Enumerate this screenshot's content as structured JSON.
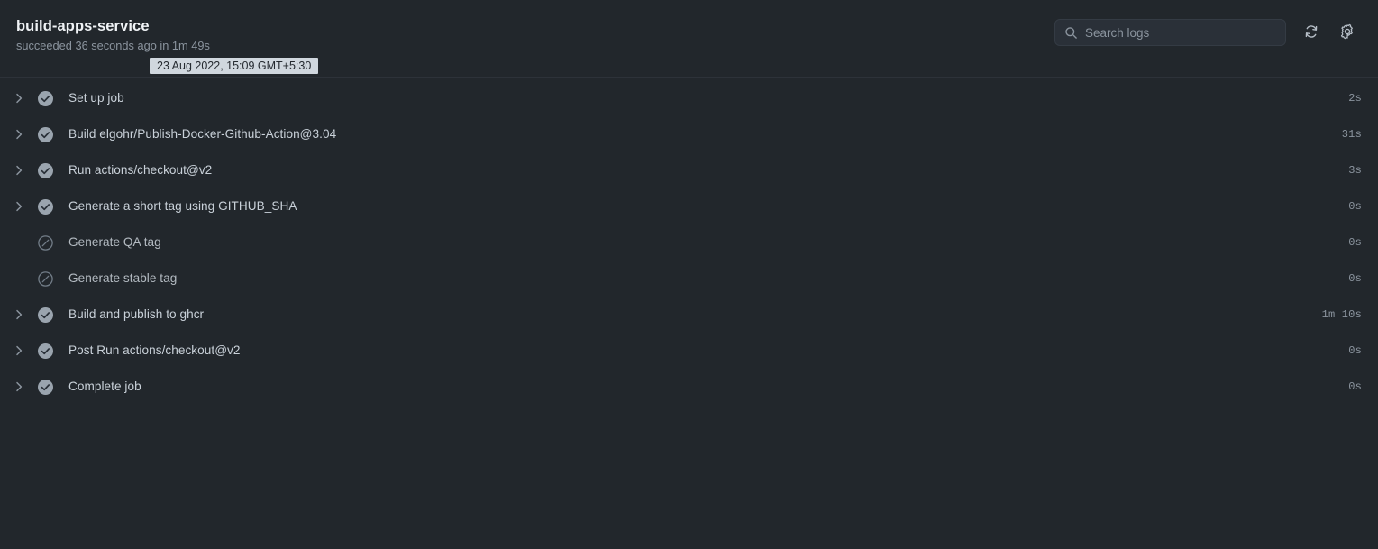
{
  "header": {
    "job_title": "build-apps-service",
    "status_line": "succeeded 36 seconds ago in 1m 49s",
    "tooltip": "23 Aug 2022, 15:09 GMT+5:30",
    "search": {
      "placeholder": "Search logs",
      "value": "",
      "icon": "search-icon"
    },
    "actions": [
      {
        "name": "refresh-button",
        "icon": "refresh-icon",
        "label": "Refresh"
      },
      {
        "name": "settings-button",
        "icon": "gear-icon",
        "label": "Settings"
      }
    ]
  },
  "steps": [
    {
      "label": "Set up job",
      "duration": "2s",
      "status": "success",
      "expandable": true
    },
    {
      "label": "Build elgohr/Publish-Docker-Github-Action@3.04",
      "duration": "31s",
      "status": "success",
      "expandable": true
    },
    {
      "label": "Run actions/checkout@v2",
      "duration": "3s",
      "status": "success",
      "expandable": true
    },
    {
      "label": "Generate a short tag using GITHUB_SHA",
      "duration": "0s",
      "status": "success",
      "expandable": true
    },
    {
      "label": "Generate QA tag",
      "duration": "0s",
      "status": "skipped",
      "expandable": false
    },
    {
      "label": "Generate stable tag",
      "duration": "0s",
      "status": "skipped",
      "expandable": false
    },
    {
      "label": "Build and publish to ghcr",
      "duration": "1m 10s",
      "status": "success",
      "expandable": true
    },
    {
      "label": "Post Run actions/checkout@v2",
      "duration": "0s",
      "status": "success",
      "expandable": true
    },
    {
      "label": "Complete job",
      "duration": "0s",
      "status": "success",
      "expandable": true
    }
  ],
  "colors": {
    "background": "#22272c",
    "divider": "#2d3239",
    "text_primary": "#c9d1d9",
    "text_muted": "#8b949e",
    "title": "#f0f3f6",
    "status_success": "#8b949e",
    "status_skipped": "#6e7681",
    "tooltip_bg": "#d0d7de",
    "tooltip_text": "#24292f",
    "search_bg": "#2a3038"
  }
}
